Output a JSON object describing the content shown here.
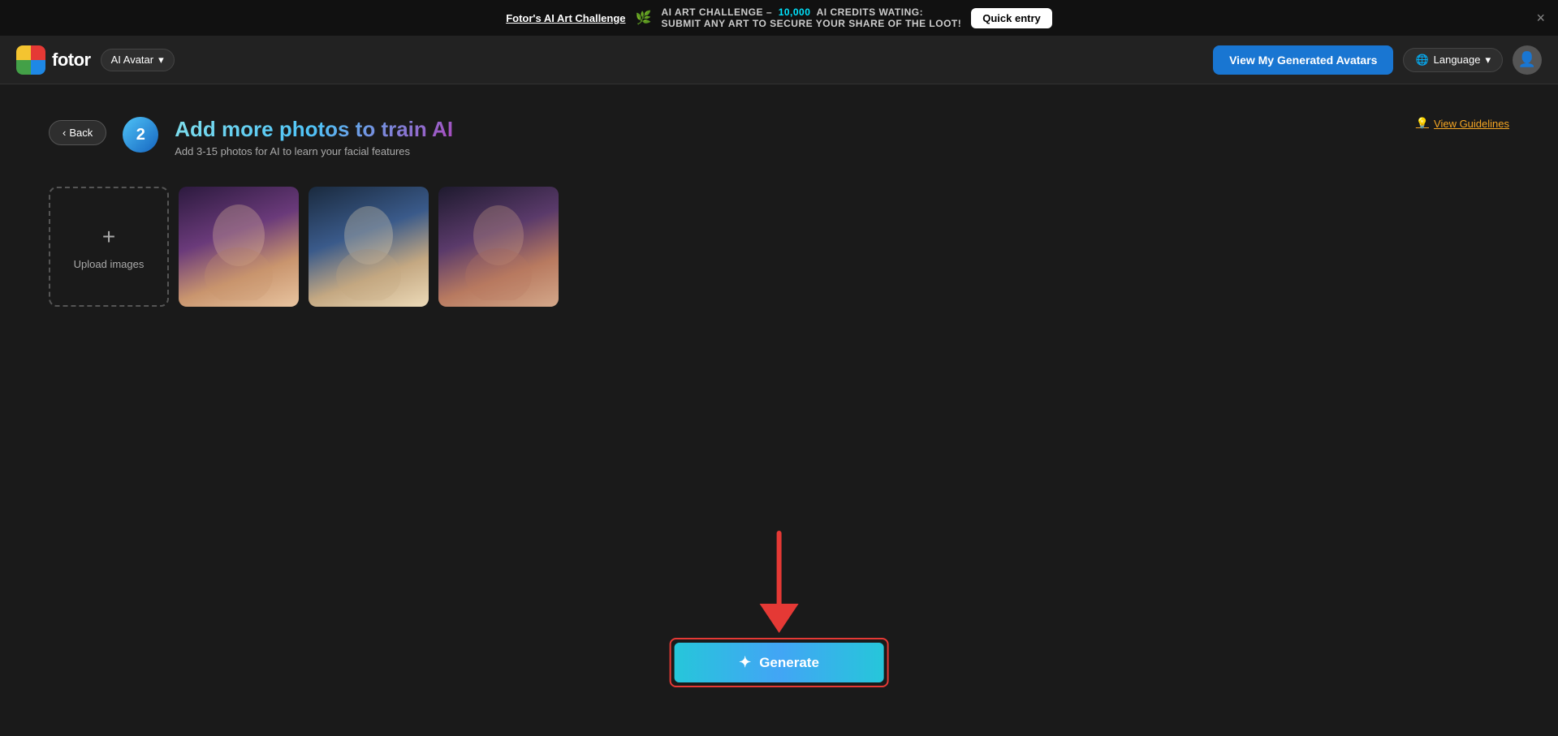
{
  "banner": {
    "challenge_link": "Fotor's AI Art Challenge",
    "leaf": "🌿",
    "prefix": "AI ART CHALLENGE –",
    "credits": "10,000",
    "suffix_before": "AI CREDITS WATING:",
    "call_to_action": "SUBMIT ANY ART TO SECURE YOUR SHARE OF THE LOOT!",
    "quick_entry_label": "Quick entry",
    "close": "×"
  },
  "header": {
    "logo_name": "fotor",
    "ai_avatar_label": "AI Avatar",
    "chevron": "▾",
    "view_avatars_label": "View My Generated Avatars",
    "language_label": "Language",
    "language_chevron": "▾",
    "globe_icon": "🌐"
  },
  "step": {
    "back_label": "Back",
    "step_number": "2",
    "title": "Add more photos to train AI",
    "subtitle": "Add 3-15 photos for AI to learn your facial features",
    "guidelines_label": "View Guidelines",
    "bulb": "💡"
  },
  "upload": {
    "label": "Upload images",
    "plus": "+"
  },
  "generate": {
    "label": "Generate",
    "wand": "✦"
  },
  "photos": [
    {
      "id": "photo1",
      "alt": "AI portrait 1"
    },
    {
      "id": "photo2",
      "alt": "AI portrait 2"
    },
    {
      "id": "photo3",
      "alt": "AI portrait 3"
    }
  ]
}
